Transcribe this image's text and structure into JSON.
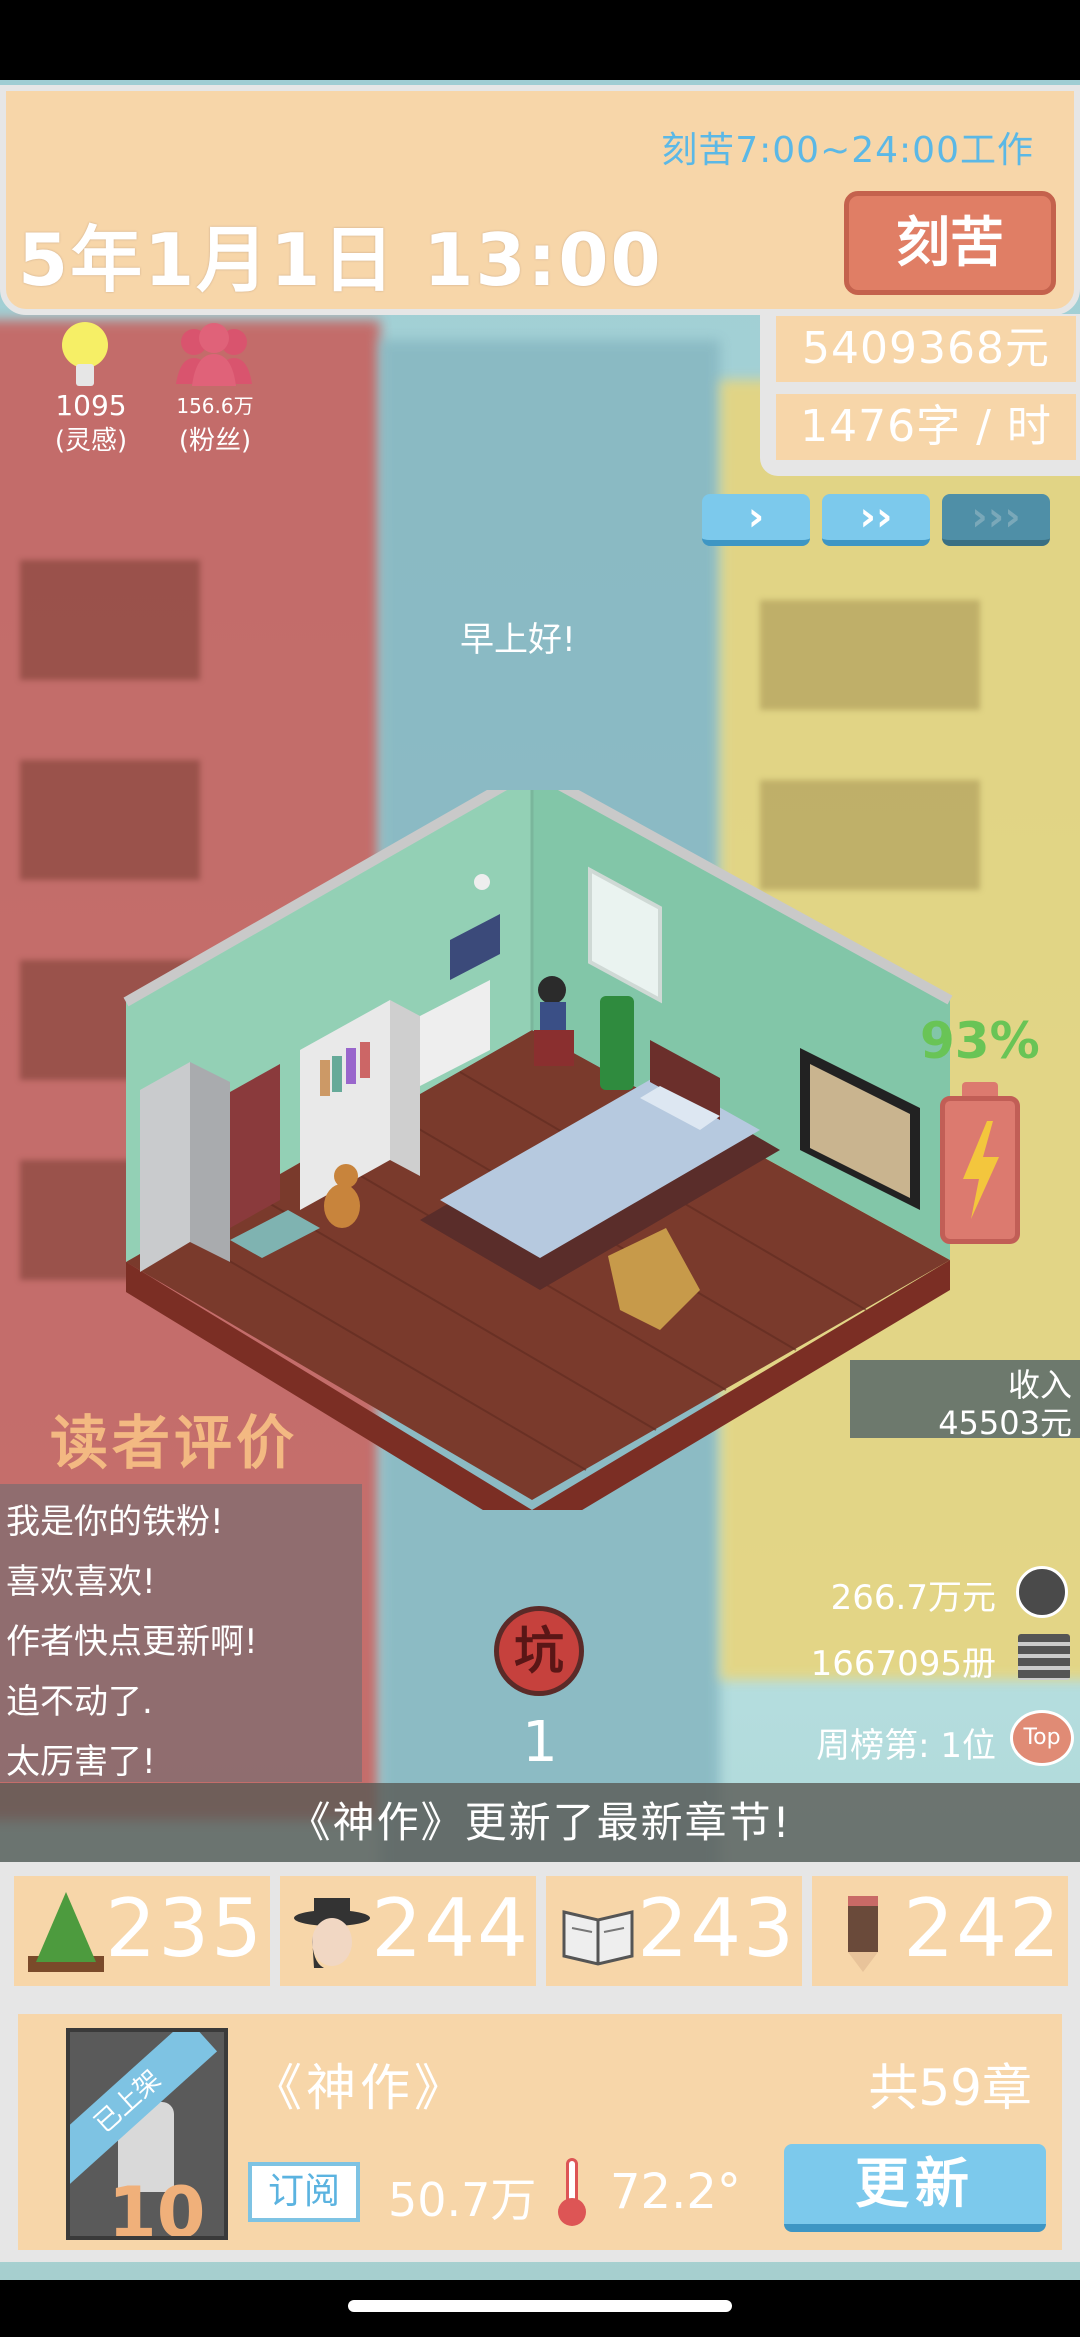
{
  "header": {
    "work_hours": "刻苦7:00~24:00工作",
    "date_time": "5年1月1日   13:00",
    "mode_button": "刻苦"
  },
  "money": {
    "balance": "5409368元",
    "writing_speed": "1476字 / 时"
  },
  "stats": {
    "inspiration_value": "1095",
    "inspiration_label": "(灵感)",
    "fans_value": "156.6万",
    "fans_label": "(粉丝)"
  },
  "speed_controls": {
    "speed1": "›",
    "speed2": "››",
    "speed3": "›››"
  },
  "greeting": "早上好!",
  "battery": {
    "percent": "93%",
    "level": 0.93
  },
  "income": {
    "label": "收入",
    "value": "45503元"
  },
  "reviews": {
    "title": "读者评价",
    "items": [
      "我是你的铁粉!",
      "喜欢喜欢!",
      "作者快点更新啊!",
      "追不动了.",
      "太厉害了!"
    ]
  },
  "pit": {
    "icon_label": "坑",
    "count": "1"
  },
  "right_stats": {
    "film_value": "266.7万元",
    "books_value": "1667095册",
    "rank": "周榜第: 1位",
    "top_label": "Top"
  },
  "ticker": "《神作》更新了最新章节!",
  "attributes": [
    {
      "icon": "tree-icon",
      "value": "235"
    },
    {
      "icon": "detective-icon",
      "value": "244"
    },
    {
      "icon": "open-book-icon",
      "value": "243"
    },
    {
      "icon": "pencil-icon",
      "value": "242"
    }
  ],
  "book": {
    "ribbon": "已上架",
    "level": "10",
    "title": "《神作》",
    "chapters": "共59章",
    "subscribe_label": "订阅",
    "subscribers": "50.7万",
    "heat": "72.2°",
    "update_button": "更新"
  },
  "colors": {
    "panel": "#f7d6a9",
    "accent_blue": "#7cc9ec",
    "accent_red": "#e07e65",
    "battery_green": "#69c456"
  }
}
